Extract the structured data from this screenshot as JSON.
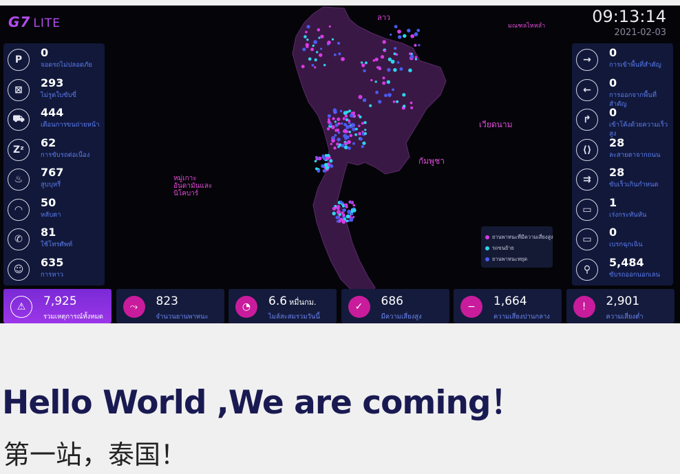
{
  "brand": {
    "logo": "G7",
    "edition": "LITE"
  },
  "clock": {
    "time": "09:13:14",
    "date": "2021-02-03"
  },
  "map": {
    "labels": {
      "laos": "ลาว",
      "myanmar_region": "มณฑลไหหลำ",
      "vietnam": "เวียดนาม",
      "cambodia": "กัมพูชา",
      "islands": "หมู่เกาะอันดามันและนิโคบาร์"
    },
    "legend": [
      {
        "label": "ยานพาหนะที่มีความเสี่ยงสูง",
        "color": "#d63be6"
      },
      {
        "label": "รถขนย้าย",
        "color": "#2fd4ec"
      },
      {
        "label": "ยานพาหนะหยุด",
        "color": "#4a5cf0"
      }
    ],
    "colors": {
      "land": "#3a1845",
      "border": "#5a2a6a",
      "high_risk": "#d63be6",
      "moving": "#2fd4ec",
      "stopped": "#4a5cf0"
    }
  },
  "left_stats": [
    {
      "icon": "parking-icon",
      "glyph": "P",
      "value": "0",
      "label": "จอดรถไม่ปลอดภัย"
    },
    {
      "icon": "no-license-icon",
      "glyph": "⊠",
      "value": "293",
      "label": "ไม่รูดใบขับขี่"
    },
    {
      "icon": "cargo-alert-icon",
      "glyph": "⛟",
      "value": "444",
      "label": "เตือนการขนถ่ายหน้า"
    },
    {
      "icon": "sleep-icon",
      "glyph": "Zᶻ",
      "value": "62",
      "label": "การขับรถต่อเนื่อง"
    },
    {
      "icon": "smoking-icon",
      "glyph": "♨",
      "value": "767",
      "label": "สูบบุหรี่"
    },
    {
      "icon": "closed-eye-icon",
      "glyph": "◠",
      "value": "50",
      "label": "หลับตา"
    },
    {
      "icon": "phone-call-icon",
      "glyph": "✆",
      "value": "81",
      "label": "ใช้โทรศัพท์"
    },
    {
      "icon": "yawn-icon",
      "glyph": "☺",
      "value": "635",
      "label": "การหาว"
    }
  ],
  "right_stats": [
    {
      "icon": "enter-area-icon",
      "glyph": "→",
      "value": "0",
      "label": "การเข้าพื้นที่สำคัญ"
    },
    {
      "icon": "exit-area-icon",
      "glyph": "←",
      "value": "0",
      "label": "การออกจากพื้นที่สำคัญ"
    },
    {
      "icon": "sharp-turn-icon",
      "glyph": "↱",
      "value": "0",
      "label": "เข้าโค้งด้วยความเร็วสูง"
    },
    {
      "icon": "lane-departure-icon",
      "glyph": "⟨⟩",
      "value": "28",
      "label": "ละสายตาจากถนน"
    },
    {
      "icon": "speeding-icon",
      "glyph": "⇉",
      "value": "28",
      "label": "ขับเร็วเกินกำหนด"
    },
    {
      "icon": "hard-acceleration-icon",
      "glyph": "▭",
      "value": "1",
      "label": "เร่งกระทันหัน"
    },
    {
      "icon": "hard-brake-icon",
      "glyph": "▭",
      "value": "0",
      "label": "เบรกฉุกเฉิน"
    },
    {
      "icon": "off-route-icon",
      "glyph": "⚲",
      "value": "5,484",
      "label": "ขับรถออกนอกเลน"
    }
  ],
  "bottom_stats": [
    {
      "icon": "warning-icon",
      "glyph": "⚠",
      "value": "7,925",
      "unit": "",
      "label": "รวมเหตุการณ์ทั้งหมด"
    },
    {
      "icon": "route-icon",
      "glyph": "⤳",
      "value": "823",
      "unit": "",
      "label": "จำนวนยานพาหนะ"
    },
    {
      "icon": "gauge-icon",
      "glyph": "◔",
      "value": "6.6",
      "unit": "หมื่นกม.",
      "label": "ไมล์สะสมรวมวันนี้"
    },
    {
      "icon": "shield-trend-icon",
      "glyph": "✓",
      "value": "686",
      "unit": "",
      "label": "มีความเสี่ยงสูง"
    },
    {
      "icon": "shield-medium-icon",
      "glyph": "−",
      "value": "1,664",
      "unit": "",
      "label": "ความเสี่ยงปานกลาง"
    },
    {
      "icon": "shield-low-icon",
      "glyph": "!",
      "value": "2,901",
      "unit": "",
      "label": "ความเสี่ยงต่ำ"
    }
  ],
  "headline": "Hello World ,We are coming！",
  "subline": "第一站，泰国！"
}
